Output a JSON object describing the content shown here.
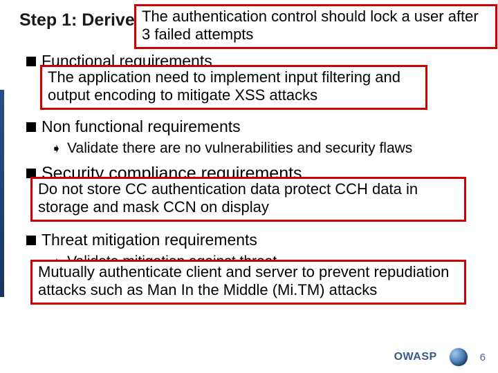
{
  "title": "Step 1: Derive",
  "callouts": {
    "c1": "The authentication control should lock a user after 3 failed attempts",
    "c2": "The application need to implement input filtering and output encoding to mitigate XSS attacks",
    "c3": "Do not store CC authentication data protect CCH data in storage and mask CCN on display",
    "c4": "Mutually authenticate client and server to prevent repudiation attacks such as Man In the Middle (Mi.TM) attacks"
  },
  "sections": {
    "functional": {
      "heading": "Functional requirements"
    },
    "nonfunctional": {
      "heading": "Non functional requirements",
      "item": "Validate there are no vulnerabilities and security flaws"
    },
    "compliance": {
      "heading": "Security compliance requirements"
    },
    "threat": {
      "heading": "Threat mitigation requirements",
      "item": "Validate mitigation against threat"
    }
  },
  "footer": {
    "org": "OWASP",
    "slide_number": "6"
  }
}
